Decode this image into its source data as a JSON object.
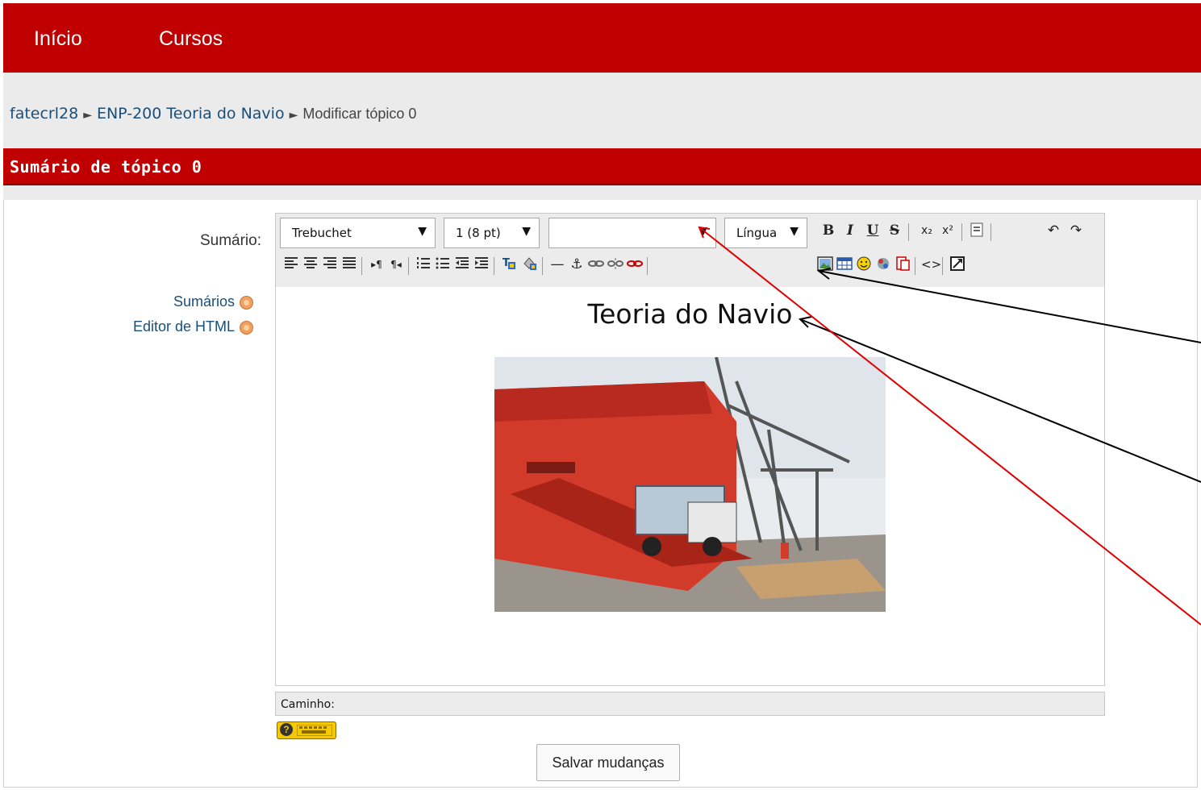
{
  "nav": {
    "inicio": "Início",
    "cursos": "Cursos",
    "bg": "#c00000"
  },
  "breadcrumb": {
    "site": "fatecrl28",
    "course": "ENP-200 Teoria do Navio",
    "current": "Modificar tópico 0",
    "sep": "►"
  },
  "section": {
    "title": "Sumário de tópico 0"
  },
  "form": {
    "summary_label": "Sumário:",
    "help_sumarios": "Sumários",
    "help_editor": "Editor de HTML",
    "save_button": "Salvar mudanças",
    "path_label": "Caminho:",
    "help_badge": "?"
  },
  "toolbar": {
    "font": "Trebuchet",
    "size": "1 (8 pt)",
    "format": "",
    "language": "Língua",
    "arrow": "▼",
    "bold": "B",
    "italic": "I",
    "underline": "U",
    "strike": "S",
    "subscript": "x₂",
    "superscript": "x²",
    "undo": "↶",
    "redo": "↷",
    "ltr": "▸¶",
    "rtl": "¶◂",
    "hr": "—",
    "anchor": "⚓",
    "code": "<>"
  },
  "editor": {
    "heading": "Teoria do Navio"
  },
  "annotation_colors": {
    "black": "#000000",
    "red": "#e00000"
  }
}
